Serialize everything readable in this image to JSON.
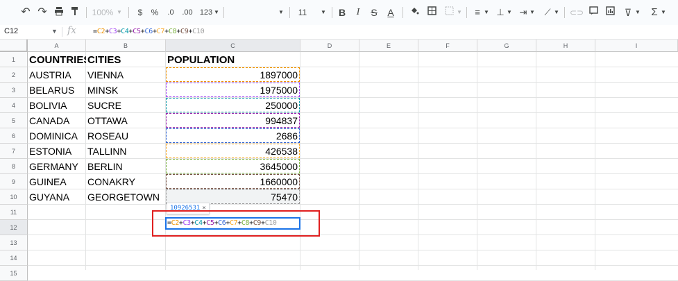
{
  "toolbar": {
    "zoom": "100%",
    "currency": "$",
    "percent": "%",
    "dec_decrease": ".0",
    "dec_increase": ".00",
    "format_more": "123",
    "font_size": "11"
  },
  "formula_bar": {
    "cell_ref": "C12",
    "fx_label": "fx",
    "formula_parts": [
      {
        "t": "=",
        "c": "#202124"
      },
      {
        "t": "C2",
        "c": "#f09300"
      },
      {
        "t": "+",
        "c": "#202124"
      },
      {
        "t": "C3",
        "c": "#a142f4"
      },
      {
        "t": "+",
        "c": "#202124"
      },
      {
        "t": "C4",
        "c": "#0097a7"
      },
      {
        "t": "+",
        "c": "#202124"
      },
      {
        "t": "C5",
        "c": "#9c27b0"
      },
      {
        "t": "+",
        "c": "#202124"
      },
      {
        "t": "C6",
        "c": "#3367d6"
      },
      {
        "t": "+",
        "c": "#202124"
      },
      {
        "t": "C7",
        "c": "#f9a825"
      },
      {
        "t": "+",
        "c": "#202124"
      },
      {
        "t": "C8",
        "c": "#7cb342"
      },
      {
        "t": "+",
        "c": "#202124"
      },
      {
        "t": "C9",
        "c": "#795548"
      },
      {
        "t": "+",
        "c": "#202124"
      },
      {
        "t": "C10",
        "c": "#9e9e9e"
      }
    ]
  },
  "columns": [
    "A",
    "B",
    "C",
    "D",
    "E",
    "F",
    "G",
    "H",
    "I"
  ],
  "rows": [
    "1",
    "2",
    "3",
    "4",
    "5",
    "6",
    "7",
    "8",
    "9",
    "10",
    "11",
    "12",
    "13",
    "14",
    "15"
  ],
  "header": {
    "countries": "COUNTRIES",
    "cities": "CITIES",
    "population": "POPULATION"
  },
  "data_rows": [
    {
      "country": "AUSTRIA",
      "city": "VIENNA",
      "population": "1897000",
      "color": "#f09300"
    },
    {
      "country": "BELARUS",
      "city": "MINSK",
      "population": "1975000",
      "color": "#a142f4"
    },
    {
      "country": "BOLIVIA",
      "city": "SUCRE",
      "population": "250000",
      "color": "#0097a7"
    },
    {
      "country": "CANADA",
      "city": "OTTAWA",
      "population": "994837",
      "color": "#9c27b0"
    },
    {
      "country": "DOMINICA",
      "city": "ROSEAU",
      "population": "2686",
      "color": "#3367d6"
    },
    {
      "country": "ESTONIA",
      "city": "TALLINN",
      "population": "426538",
      "color": "#f9a825"
    },
    {
      "country": "GERMANY",
      "city": "BERLIN",
      "population": "3645000",
      "color": "#7cb342"
    },
    {
      "country": "GUINEA",
      "city": "CONAKRY",
      "population": "1660000",
      "color": "#795548"
    },
    {
      "country": "GUYANA",
      "city": "GEORGETOWN",
      "population": "75470",
      "color": "#9e9e9e"
    }
  ],
  "tooltip": {
    "value": "10926531",
    "close": "×"
  },
  "colors": {
    "highlight_border": "#e02020",
    "active_border": "#1a73e8"
  }
}
